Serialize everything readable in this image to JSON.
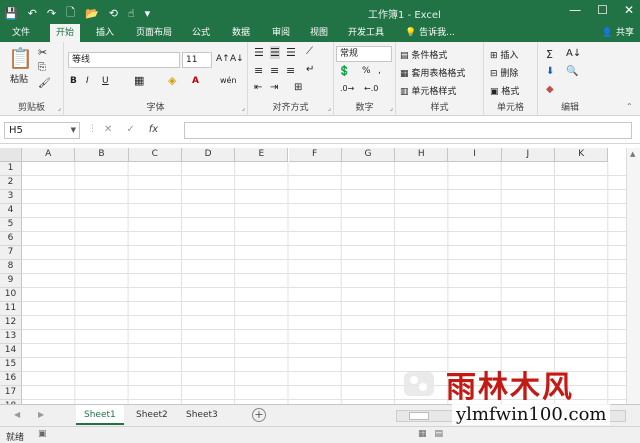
{
  "window": {
    "title": "工作簿1 - Excel",
    "min_glyph": "—",
    "max_glyph": "☐",
    "close_glyph": "✕"
  },
  "qat": {
    "save_glyph": "💾",
    "undo_glyph": "↶",
    "redo_glyph": "↷",
    "new_glyph": "🗋",
    "open_glyph": "📂",
    "sync_glyph": "⟲",
    "touch_glyph": "☝",
    "more_glyph": "▾"
  },
  "tabs": [
    "文件",
    "开始",
    "插入",
    "页面布局",
    "公式",
    "数据",
    "审阅",
    "视图",
    "开发工具"
  ],
  "active_tab": "开始",
  "tellme": "告诉我...",
  "share": "共享",
  "ribbon": {
    "clipboard": {
      "label": "剪贴板",
      "paste": "粘贴"
    },
    "font": {
      "label": "字体",
      "font_name": "等线",
      "font_size": "11",
      "bold": "B",
      "italic": "I",
      "underline": "U",
      "grow": "A↑",
      "shrink": "A↓",
      "color": "A",
      "wen": "wén"
    },
    "alignment": {
      "label": "对齐方式"
    },
    "number": {
      "label": "数字",
      "format": "常规",
      "percent": "%",
      "comma": ","
    },
    "styles": {
      "label": "样式",
      "conditional": "条件格式",
      "table": "套用表格格式",
      "cell_styles": "单元格样式"
    },
    "cells": {
      "label": "单元格",
      "insert": "插入",
      "delete": "删除",
      "format": "格式"
    },
    "editing": {
      "label": "编辑",
      "sum": "Σ"
    }
  },
  "formula_bar": {
    "name_box": "H5",
    "cancel": "✕",
    "enter": "✓",
    "fx": "fx",
    "content": ""
  },
  "columns": [
    "A",
    "B",
    "C",
    "D",
    "E",
    "F",
    "G",
    "H",
    "I",
    "J",
    "K"
  ],
  "rows": [
    "1",
    "2",
    "3",
    "4",
    "5",
    "6",
    "7",
    "8",
    "9",
    "10",
    "11",
    "12",
    "13",
    "14",
    "15",
    "16",
    "17",
    "18"
  ],
  "sheets": [
    "Sheet1",
    "Sheet2",
    "Sheet3"
  ],
  "active_sheet": "Sheet1",
  "status": {
    "text": "就绪"
  },
  "watermark": {
    "cn": "雨林木风",
    "url": "ylmfwin100.com"
  },
  "colors": {
    "accent": "#217346",
    "watermark_red": "#c41a14"
  }
}
